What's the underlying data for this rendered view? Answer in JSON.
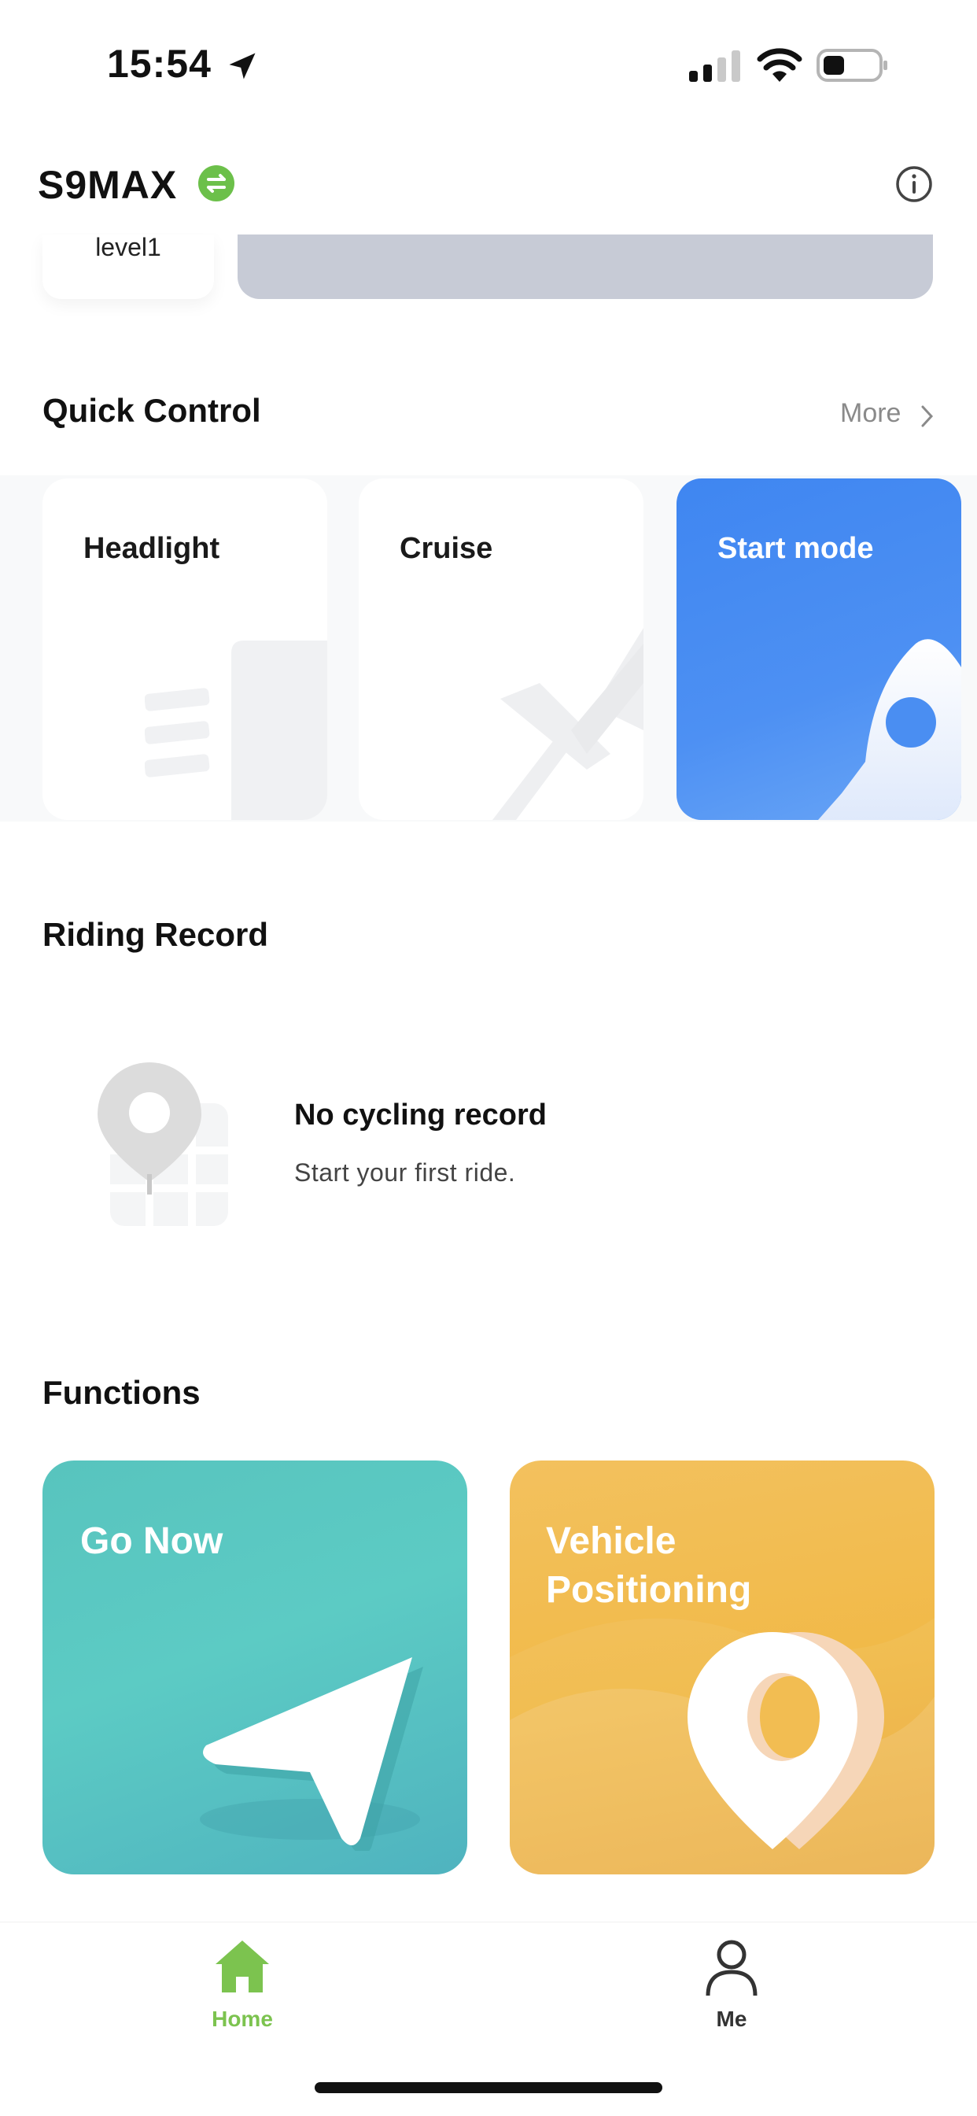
{
  "status_bar": {
    "time": "15:54"
  },
  "header": {
    "device_name": "S9MAX"
  },
  "top_cards": {
    "level_label": "level1"
  },
  "quick_control": {
    "title": "Quick Control",
    "more_label": "More",
    "cards": [
      {
        "label": "Headlight",
        "icon": "headlight-icon",
        "active": false
      },
      {
        "label": "Cruise",
        "icon": "cruise-icon",
        "active": false
      },
      {
        "label": "Start mode",
        "icon": "rocket-icon",
        "active": true
      }
    ]
  },
  "riding_record": {
    "title": "Riding Record",
    "empty_title": "No cycling record",
    "empty_subtitle": "Start your first ride."
  },
  "functions": {
    "title": "Functions",
    "cards": [
      {
        "label": "Go Now",
        "icon": "navigation-arrow-icon",
        "color": "#5cc9c3"
      },
      {
        "label": "Vehicle Positioning",
        "icon": "location-pin-icon",
        "color": "#f2bd52"
      }
    ]
  },
  "tab_bar": {
    "items": [
      {
        "label": "Home",
        "icon": "home-icon",
        "active": true,
        "color": "#7cc34f"
      },
      {
        "label": "Me",
        "icon": "person-icon",
        "active": false,
        "color": "#333333"
      }
    ]
  },
  "colors": {
    "accent_green": "#6cc04a",
    "start_mode_blue": "#4a8ef2",
    "go_now_teal": "#5cc9c3",
    "positioning_yellow": "#f2bd52"
  }
}
